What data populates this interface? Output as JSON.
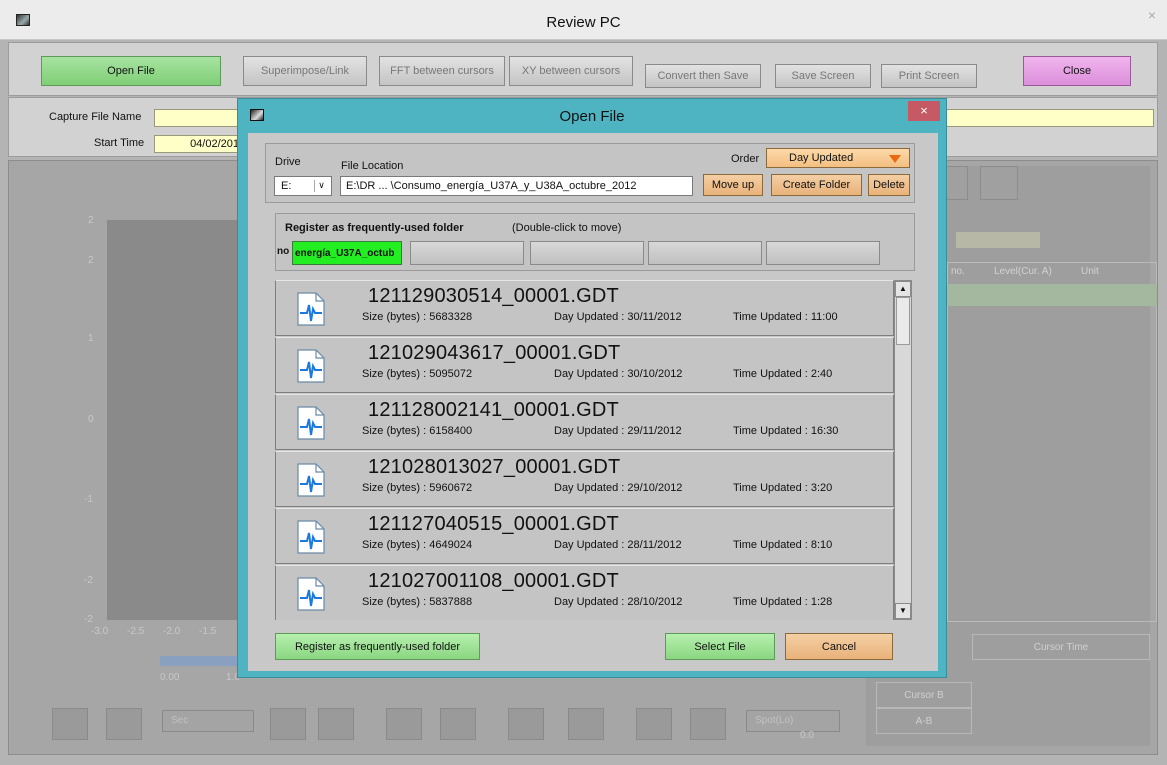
{
  "window": {
    "title": "Review PC"
  },
  "toolbar": {
    "open_file": "Open File",
    "superimpose": "Superimpose/Link",
    "fft": "FFT between cursors",
    "xy": "XY between cursors",
    "convert": "Convert then Save",
    "save_screen": "Save Screen",
    "print_screen": "Print Screen",
    "close": "Close"
  },
  "info": {
    "capture_label": "Capture File Name",
    "start_label": "Start Time",
    "start_value": "04/02/201"
  },
  "background": {
    "y_ticks": [
      "2",
      "2",
      "1",
      "0",
      "-1",
      "-2",
      "-2"
    ],
    "x_ticks": [
      "-3.0",
      "-2.5",
      "-2.0",
      "-1.5"
    ],
    "grid_headers": {
      "no": "no.",
      "level": "Level(Cur. A)",
      "unit": "Unit"
    },
    "cursor_panel": {
      "cursor_time": "Cursor Time",
      "cursor_b": "Cursor B",
      "a_b": "A-B"
    },
    "sec_dropdown": "Sec",
    "spot_dropdown": "Spot(Lo)",
    "spot_value": "0.0",
    "scale_min": "0.00",
    "scale_max": "1.0"
  },
  "dialog": {
    "title": "Open File",
    "close_glyph": "×",
    "drive_label": "Drive",
    "drive_value": "E:",
    "location_label": "File Location",
    "location_value": "E:\\DR ... \\Consumo_energía_U37A_y_U38A_octubre_2012",
    "order_label": "Order",
    "order_value": "Day Updated",
    "move_up": "Move up",
    "create_folder": "Create Folder",
    "delete": "Delete",
    "register_title": "Register as frequently-used folder",
    "register_hint": "(Double-click to move)",
    "folder_slot_prefix": "no",
    "folder_slot_1": "energía_U37A_octub",
    "register_button": "Register as frequently-used folder",
    "select_file": "Select File",
    "cancel": "Cancel"
  },
  "files": [
    {
      "name": "121129030514_00001.GDT",
      "size": "Size (bytes) : 5683328",
      "day": "Day Updated : 30/11/2012",
      "time": "Time Updated : 11:00"
    },
    {
      "name": "121029043617_00001.GDT",
      "size": "Size (bytes) : 5095072",
      "day": "Day Updated : 30/10/2012",
      "time": "Time Updated : 2:40"
    },
    {
      "name": "121128002141_00001.GDT",
      "size": "Size (bytes) : 6158400",
      "day": "Day Updated : 29/11/2012",
      "time": "Time Updated : 16:30"
    },
    {
      "name": "121028013027_00001.GDT",
      "size": "Size (bytes) : 5960672",
      "day": "Day Updated : 29/10/2012",
      "time": "Time Updated : 3:20"
    },
    {
      "name": "121127040515_00001.GDT",
      "size": "Size (bytes) : 4649024",
      "day": "Day Updated : 28/11/2012",
      "time": "Time Updated : 8:10"
    },
    {
      "name": "121027001108_00001.GDT",
      "size": "Size (bytes) : 5837888",
      "day": "Day Updated : 28/10/2012",
      "time": "Time Updated : 1:28"
    }
  ],
  "colors": {
    "dialog_frame": "#4fb4c2",
    "accent_green": "#8ad682",
    "accent_orange": "#f2c07a",
    "accent_pink": "#dc8fda",
    "folder_slot_green": "#22ee22"
  }
}
